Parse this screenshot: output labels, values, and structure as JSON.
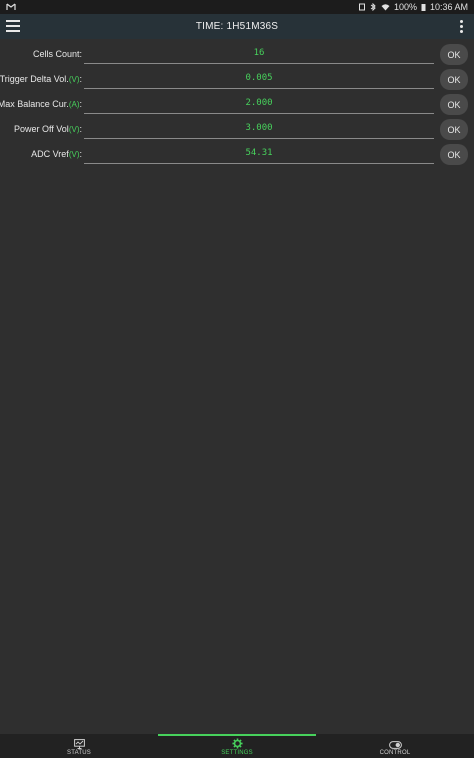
{
  "statusbar": {
    "battery": "100%",
    "time": "10:36 AM"
  },
  "appbar": {
    "title": "TIME: 1H51M36S"
  },
  "settings": [
    {
      "label": "Cells Count:",
      "unit": "",
      "value": "16",
      "button": "OK"
    },
    {
      "label": "Trigger Delta Vol.",
      "unit": "(V)",
      "suffix": ":",
      "value": "0.005",
      "button": "OK"
    },
    {
      "label": "Max Balance Cur.",
      "unit": "(A)",
      "suffix": ":",
      "value": "2.000",
      "button": "OK"
    },
    {
      "label": "Power Off Vol",
      "unit": "(V)",
      "suffix": ":",
      "value": "3.000",
      "button": "OK"
    },
    {
      "label": "ADC Vref",
      "unit": "(V)",
      "suffix": ":",
      "value": "54.31",
      "button": "OK"
    }
  ],
  "bottomnav": {
    "tabs": [
      {
        "label": "STATUS",
        "icon": "monitor-icon"
      },
      {
        "label": "SETTINGS",
        "icon": "gear-icon"
      },
      {
        "label": "CONTROL",
        "icon": "toggle-icon"
      }
    ],
    "active_tab": "SETTINGS"
  },
  "colors": {
    "accent": "#47d15c",
    "appbar": "#273238",
    "background": "#2f2f2f"
  }
}
